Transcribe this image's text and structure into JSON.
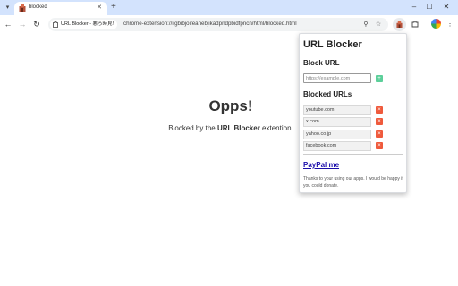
{
  "browser": {
    "tab": {
      "title": "blocked"
    },
    "window_controls": {
      "minimize": "–",
      "maximize": "☐",
      "close": "✕"
    },
    "toolbar": {
      "back": "←",
      "forward": "→",
      "reload": "↻",
      "site_chip": "URL Blocker - 悪ろ時見!",
      "url": "chrome-extension://iigbibjoifeanebjikadpndpbidfpncn/html/blocked.html"
    }
  },
  "page": {
    "heading": "Opps!",
    "message_prefix": "Blocked by the ",
    "message_app": "URL Blocker",
    "message_suffix": " extention."
  },
  "popup": {
    "title": "URL Blocker",
    "block_section": "Block URL",
    "input_placeholder": "https://example.com",
    "add_label": "+",
    "blocked_section": "Blocked URLs",
    "blocked_urls": [
      "youtube.com",
      "x.com",
      "yahoo.co.jp",
      "facebook.com"
    ],
    "remove_label": "×",
    "paypal_link": "PayPal me",
    "thanks": "Thanks to your using our apps. I would be happy if you could donate."
  },
  "colors": {
    "tabstrip": "#d3e3fd",
    "add_button": "#5ccf9a",
    "remove_button": "#ef5a3c",
    "link": "#1a0dab"
  }
}
